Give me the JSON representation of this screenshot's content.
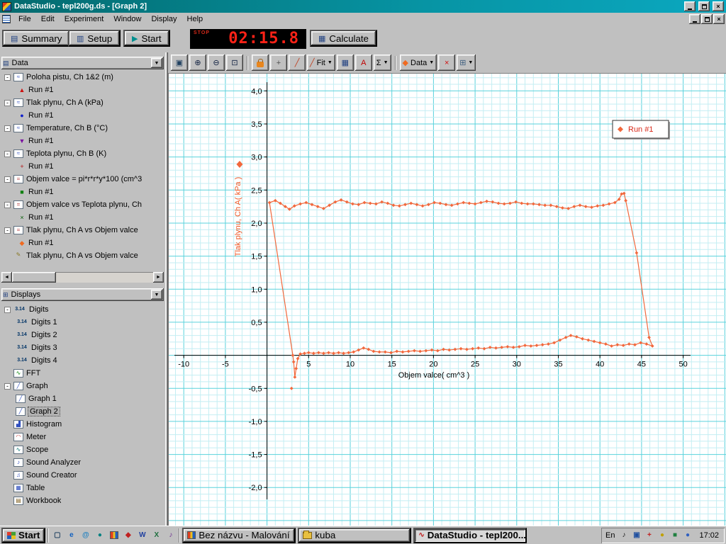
{
  "window": {
    "title": "DataStudio - tepl200g.ds - [Graph 2]"
  },
  "menu": {
    "items": [
      "File",
      "Edit",
      "Experiment",
      "Window",
      "Display",
      "Help"
    ]
  },
  "toolbar": {
    "summary_label": "Summary",
    "setup_label": "Setup",
    "start_label": "Start",
    "calculate_label": "Calculate",
    "timer": {
      "status": "STOP",
      "value": "02:15.8"
    }
  },
  "graph_toolbar": {
    "buttons": [
      {
        "name": "scale-to-fit-button",
        "icon": "scale-to-fit-icon"
      },
      {
        "name": "zoom-in-button",
        "icon": "zoom-in-icon"
      },
      {
        "name": "zoom-out-button",
        "icon": "zoom-out-icon"
      },
      {
        "name": "zoom-select-button",
        "icon": "zoom-select-icon"
      },
      {
        "name": "data-align-button",
        "icon": "lock-icon"
      },
      {
        "name": "smart-tool-button",
        "icon": "crosshair-icon"
      },
      {
        "name": "slope-tool-button",
        "icon": "slope-icon"
      },
      {
        "name": "fit-button",
        "icon": "slope-icon",
        "label": "Fit",
        "dropdown": true
      },
      {
        "name": "calculator-tool-button",
        "icon": "calculator-icon"
      },
      {
        "name": "annotate-button",
        "icon": "annotate-icon"
      },
      {
        "name": "statistics-button",
        "icon": "sigma-icon",
        "dropdown": true
      },
      {
        "name": "data-menu-button",
        "icon": "diamond-icon",
        "label": "Data",
        "dropdown": true
      },
      {
        "name": "delete-button",
        "icon": "delete-icon"
      },
      {
        "name": "graph-settings-button",
        "icon": "grid-icon",
        "dropdown": true
      }
    ]
  },
  "sidebar": {
    "data_panel": {
      "title": "Data",
      "items": [
        {
          "label": "Poloha pistu, Ch 1&2 (m)",
          "icon": "sensor-icon",
          "runs": [
            {
              "label": "Run #1",
              "marker": "triangle-up",
              "color": "#cc1010"
            }
          ]
        },
        {
          "label": "Tlak plynu, Ch A (kPa)",
          "icon": "sensor-icon",
          "runs": [
            {
              "label": "Run #1",
              "marker": "circle",
              "color": "#1020cc"
            }
          ]
        },
        {
          "label": "Temperature, Ch B (°C)",
          "icon": "sensor-icon",
          "runs": [
            {
              "label": "Run #1",
              "marker": "triangle-down",
              "color": "#7a10a0"
            }
          ]
        },
        {
          "label": "Teplota plynu, Ch B (K)",
          "icon": "sensor-icon",
          "runs": [
            {
              "label": "Run #1",
              "marker": "plus",
              "color": "#b01010"
            }
          ]
        },
        {
          "label": "Objem valce = pi*r*r*y*100 (cm^3",
          "icon": "calc-data-icon",
          "runs": [
            {
              "label": "Run #1",
              "marker": "square",
              "color": "#108010"
            }
          ]
        },
        {
          "label": "Objem valce vs Teplota plynu, Ch",
          "icon": "calc-data-icon",
          "runs": [
            {
              "label": "Run #1",
              "marker": "x",
              "color": "#0a600a"
            }
          ]
        },
        {
          "label": "Tlak plynu, Ch A vs Objem valce",
          "icon": "calc-data-icon",
          "runs": [
            {
              "label": "Run #1",
              "marker": "diamond",
              "color": "#f06a20"
            }
          ]
        },
        {
          "label": "Tlak plynu, Ch A vs Objem valce",
          "icon": "pencil-icon",
          "runs": []
        }
      ]
    },
    "displays_panel": {
      "title": "Displays",
      "items": [
        {
          "label": "Digits",
          "icon": "digits-icon",
          "children": [
            "Digits 1",
            "Digits 2",
            "Digits 3",
            "Digits 4"
          ]
        },
        {
          "label": "FFT",
          "icon": "fft-icon"
        },
        {
          "label": "Graph",
          "icon": "graph-icon",
          "children": [
            "Graph 1",
            "Graph 2"
          ],
          "selected": "Graph 2"
        },
        {
          "label": "Histogram",
          "icon": "histogram-icon"
        },
        {
          "label": "Meter",
          "icon": "meter-icon"
        },
        {
          "label": "Scope",
          "icon": "scope-icon"
        },
        {
          "label": "Sound Analyzer",
          "icon": "sound-analyzer-icon"
        },
        {
          "label": "Sound Creator",
          "icon": "sound-creator-icon"
        },
        {
          "label": "Table",
          "icon": "table-icon"
        },
        {
          "label": "Workbook",
          "icon": "workbook-icon"
        }
      ]
    }
  },
  "chart_data": {
    "type": "scatter",
    "title": "",
    "xlabel": "Objem valce( cm^3 )",
    "ylabel": "Tlak plynu, Ch A( kPa )",
    "xlim": [
      -11.9,
      55.2
    ],
    "ylim": [
      -2.6,
      4.26
    ],
    "grid": true,
    "legend_position": "top-right",
    "xticks": [
      [
        -10,
        "-10"
      ],
      [
        -5,
        "-5"
      ],
      [
        5,
        "5"
      ],
      [
        10,
        "10"
      ],
      [
        15,
        "15"
      ],
      [
        20,
        "20"
      ],
      [
        25,
        "25"
      ],
      [
        30,
        "30"
      ],
      [
        35,
        "35"
      ],
      [
        40,
        "40"
      ],
      [
        45,
        "45"
      ],
      [
        50,
        "50"
      ]
    ],
    "yticks": [
      [
        4,
        "4,0"
      ],
      [
        3.5,
        "3,5"
      ],
      [
        3,
        "3,0"
      ],
      [
        2.5,
        "2,5"
      ],
      [
        2,
        "2,0"
      ],
      [
        1.5,
        "1,5"
      ],
      [
        1,
        "1,0"
      ],
      [
        0.5,
        "0,5"
      ],
      [
        -0.5,
        "-0,5"
      ],
      [
        -1,
        "-1,0"
      ],
      [
        -1.5,
        "-1,5"
      ],
      [
        -2,
        "-2,0"
      ]
    ],
    "colors": {
      "grid_minor": "#c4eef3",
      "grid_major": "#5ad2dc",
      "series": "#f2683c",
      "legend_text": "#d92818",
      "ylabel": "#f05a28",
      "axis": "#000000"
    },
    "series": [
      {
        "name": "Run #1",
        "marker": "diamond",
        "points": [
          [
            0.3,
            2.31
          ],
          [
            1,
            2.34
          ],
          [
            1.6,
            2.3
          ],
          [
            2.2,
            2.25
          ],
          [
            2.7,
            2.21
          ],
          [
            3.3,
            2.26
          ],
          [
            4,
            2.29
          ],
          [
            4.7,
            2.31
          ],
          [
            5.4,
            2.28
          ],
          [
            6.1,
            2.25
          ],
          [
            6.8,
            2.22
          ],
          [
            7.5,
            2.27
          ],
          [
            8.2,
            2.32
          ],
          [
            8.9,
            2.35
          ],
          [
            9.6,
            2.32
          ],
          [
            10.3,
            2.29
          ],
          [
            11,
            2.28
          ],
          [
            11.7,
            2.31
          ],
          [
            12.4,
            2.3
          ],
          [
            13.1,
            2.29
          ],
          [
            13.8,
            2.32
          ],
          [
            14.5,
            2.3
          ],
          [
            15.2,
            2.27
          ],
          [
            15.9,
            2.26
          ],
          [
            16.6,
            2.28
          ],
          [
            17.3,
            2.3
          ],
          [
            18,
            2.28
          ],
          [
            18.7,
            2.26
          ],
          [
            19.4,
            2.28
          ],
          [
            20.1,
            2.31
          ],
          [
            20.8,
            2.3
          ],
          [
            21.5,
            2.28
          ],
          [
            22.2,
            2.27
          ],
          [
            22.9,
            2.29
          ],
          [
            23.6,
            2.31
          ],
          [
            24.3,
            2.3
          ],
          [
            25,
            2.29
          ],
          [
            25.7,
            2.31
          ],
          [
            26.4,
            2.33
          ],
          [
            27.1,
            2.32
          ],
          [
            27.8,
            2.3
          ],
          [
            28.5,
            2.29
          ],
          [
            29.2,
            2.3
          ],
          [
            29.9,
            2.32
          ],
          [
            30.6,
            2.3
          ],
          [
            31.3,
            2.29
          ],
          [
            32,
            2.29
          ],
          [
            32.7,
            2.28
          ],
          [
            33.4,
            2.27
          ],
          [
            34.1,
            2.27
          ],
          [
            34.8,
            2.25
          ],
          [
            35.5,
            2.23
          ],
          [
            36.2,
            2.22
          ],
          [
            36.9,
            2.25
          ],
          [
            37.6,
            2.27
          ],
          [
            38.3,
            2.25
          ],
          [
            39,
            2.24
          ],
          [
            39.7,
            2.26
          ],
          [
            40.4,
            2.27
          ],
          [
            41.1,
            2.29
          ],
          [
            41.8,
            2.31
          ],
          [
            42.3,
            2.36
          ],
          [
            42.6,
            2.44
          ],
          [
            42.9,
            2.45
          ],
          [
            43.1,
            2.34
          ],
          [
            44.4,
            1.55
          ],
          [
            45.9,
            0.27
          ],
          [
            46.3,
            0.14
          ],
          [
            45.6,
            0.17
          ],
          [
            44.9,
            0.19
          ],
          [
            44.2,
            0.16
          ],
          [
            43.5,
            0.17
          ],
          [
            42.8,
            0.15
          ],
          [
            42.1,
            0.16
          ],
          [
            41.4,
            0.14
          ],
          [
            40.7,
            0.17
          ],
          [
            40,
            0.19
          ],
          [
            39.3,
            0.21
          ],
          [
            38.6,
            0.23
          ],
          [
            37.9,
            0.25
          ],
          [
            37.2,
            0.28
          ],
          [
            36.5,
            0.3
          ],
          [
            35.9,
            0.27
          ],
          [
            35.2,
            0.23
          ],
          [
            34.5,
            0.19
          ],
          [
            33.8,
            0.17
          ],
          [
            33.1,
            0.16
          ],
          [
            32.4,
            0.15
          ],
          [
            31.7,
            0.14
          ],
          [
            31,
            0.15
          ],
          [
            30.3,
            0.13
          ],
          [
            29.6,
            0.12
          ],
          [
            28.9,
            0.13
          ],
          [
            28.2,
            0.12
          ],
          [
            27.5,
            0.11
          ],
          [
            26.8,
            0.12
          ],
          [
            26.1,
            0.1
          ],
          [
            25.4,
            0.11
          ],
          [
            24.7,
            0.1
          ],
          [
            24,
            0.09
          ],
          [
            23.3,
            0.1
          ],
          [
            22.6,
            0.09
          ],
          [
            21.9,
            0.08
          ],
          [
            21.2,
            0.09
          ],
          [
            20.5,
            0.07
          ],
          [
            19.8,
            0.08
          ],
          [
            19.1,
            0.07
          ],
          [
            18.4,
            0.06
          ],
          [
            17.7,
            0.07
          ],
          [
            17,
            0.06
          ],
          [
            16.3,
            0.05
          ],
          [
            15.6,
            0.06
          ],
          [
            14.9,
            0.04
          ],
          [
            14.2,
            0.05
          ],
          [
            13.5,
            0.05
          ],
          [
            12.8,
            0.06
          ],
          [
            12.2,
            0.09
          ],
          [
            11.6,
            0.11
          ],
          [
            11,
            0.08
          ],
          [
            10.4,
            0.05
          ],
          [
            9.8,
            0.04
          ],
          [
            9.2,
            0.03
          ],
          [
            8.6,
            0.04
          ],
          [
            8,
            0.03
          ],
          [
            7.4,
            0.04
          ],
          [
            6.8,
            0.03
          ],
          [
            6.2,
            0.04
          ],
          [
            5.6,
            0.03
          ],
          [
            5,
            0.04
          ],
          [
            4.5,
            0.03
          ],
          [
            4,
            0.02
          ],
          [
            3.7,
            -0.05
          ],
          [
            3.5,
            -0.2
          ],
          [
            3.35,
            -0.33
          ],
          [
            3.2,
            -0.1
          ],
          [
            3.1,
            0
          ],
          [
            0.3,
            2.31
          ]
        ],
        "stray_points": [
          [
            2.95,
            -0.5
          ]
        ]
      }
    ],
    "legend": {
      "label": "Run #1"
    }
  },
  "taskbar": {
    "start_label": "Start",
    "quicklaunch": [
      "show-desktop-icon",
      "internet-explorer-icon",
      "outlook-icon",
      "channels-icon",
      "paint-icon",
      "acrobat-icon",
      "word-icon",
      "excel-icon",
      "media-icon"
    ],
    "tasks": [
      {
        "label": "Bez názvu - Malování",
        "icon": "paint-icon",
        "active": false
      },
      {
        "label": "kuba",
        "icon": "folder-icon",
        "active": false
      },
      {
        "label": "DataStudio - tepl200...",
        "icon": "datastudio-icon",
        "active": true
      }
    ],
    "tray": {
      "lang": "En",
      "time": "17:02",
      "icons": [
        "volume-icon",
        "display-icon",
        "antivirus-icon",
        "scheduler-icon",
        "network-icon",
        "update-icon"
      ]
    }
  },
  "icons": {
    "scale-to-fit-icon": {
      "glyph": "▣",
      "color": "#204060"
    },
    "zoom-in-icon": {
      "glyph": "⊕",
      "color": "#102040"
    },
    "zoom-out-icon": {
      "glyph": "⊖",
      "color": "#102040"
    },
    "zoom-select-icon": {
      "glyph": "⊡",
      "color": "#102040"
    },
    "lock-icon": {
      "css": "lock-ic"
    },
    "crosshair-icon": {
      "glyph": "+",
      "color": "#505050"
    },
    "slope-icon": {
      "glyph": "╱",
      "color": "#c04020"
    },
    "calculator-icon": {
      "glyph": "▦",
      "color": "#204080"
    },
    "annotate-icon": {
      "glyph": "A",
      "color": "#c00000"
    },
    "sigma-icon": {
      "glyph": "Σ",
      "color": "#000000"
    },
    "diamond-icon": {
      "glyph": "◆",
      "color": "#f06a20"
    },
    "delete-icon": {
      "glyph": "×",
      "color": "#d01010"
    },
    "grid-icon": {
      "glyph": "⊞",
      "color": "#406080"
    },
    "summary-icon": {
      "glyph": "▤",
      "color": "#204080"
    },
    "setup-icon": {
      "glyph": "▥",
      "color": "#204080"
    },
    "start-icon": {
      "glyph": "▶",
      "color": "#008f8f"
    },
    "calculate-icon": {
      "glyph": "▦",
      "color": "#204080"
    },
    "data-panel-icon": {
      "glyph": "▤",
      "color": "#204080"
    },
    "displays-panel-icon": {
      "glyph": "⊞",
      "color": "#204080"
    },
    "sensor-icon": {
      "glyph": "≈",
      "color": "#3050c0"
    },
    "calc-data-icon": {
      "glyph": "=",
      "color": "#b03030"
    },
    "pencil-icon": {
      "glyph": "✎",
      "color": "#887722"
    },
    "digits-icon": {
      "glyph": "3.14",
      "color": "#003366"
    },
    "fft-icon": {
      "glyph": "∿",
      "color": "#008000"
    },
    "graph-icon": {
      "glyph": "╱",
      "color": "#3050c0"
    },
    "histogram-icon": {
      "glyph": "▟",
      "color": "#3050c0"
    },
    "meter-icon": {
      "glyph": "◠",
      "color": "#c03030"
    },
    "scope-icon": {
      "glyph": "∿",
      "color": "#007070"
    },
    "sound-analyzer-icon": {
      "glyph": "♪",
      "color": "#3050c0"
    },
    "sound-creator-icon": {
      "glyph": "♫",
      "color": "#3050c0"
    },
    "table-icon": {
      "glyph": "▦",
      "color": "#3050c0"
    },
    "workbook-icon": {
      "glyph": "▤",
      "color": "#806020"
    },
    "show-desktop-icon": {
      "glyph": "▢",
      "color": "#204060"
    },
    "internet-explorer-icon": {
      "glyph": "e",
      "color": "#1060c0"
    },
    "outlook-icon": {
      "glyph": "@",
      "color": "#2080c0"
    },
    "channels-icon": {
      "glyph": "●",
      "color": "#008080"
    },
    "paint-icon": {
      "css": "paint-ic"
    },
    "acrobat-icon": {
      "glyph": "◆",
      "color": "#c02020"
    },
    "word-icon": {
      "glyph": "W",
      "color": "#2040a0"
    },
    "excel-icon": {
      "glyph": "X",
      "color": "#207040"
    },
    "media-icon": {
      "glyph": "♪",
      "color": "#703090"
    },
    "folder-icon": {
      "css": "folder-ic"
    },
    "datastudio-icon": {
      "glyph": "∿",
      "color": "#c02020"
    },
    "volume-icon": {
      "glyph": "♪",
      "color": "#202020"
    },
    "display-icon": {
      "glyph": "▣",
      "color": "#2050a0"
    },
    "antivirus-icon": {
      "glyph": "+",
      "color": "#c02020"
    },
    "scheduler-icon": {
      "glyph": "●",
      "color": "#c0a000"
    },
    "network-icon": {
      "glyph": "■",
      "color": "#208040"
    },
    "update-icon": {
      "glyph": "●",
      "color": "#3060c0"
    }
  },
  "markers": {
    "triangle-up": "▲",
    "circle": "●",
    "triangle-down": "▼",
    "plus": "+",
    "square": "■",
    "x": "×",
    "diamond": "◆"
  }
}
